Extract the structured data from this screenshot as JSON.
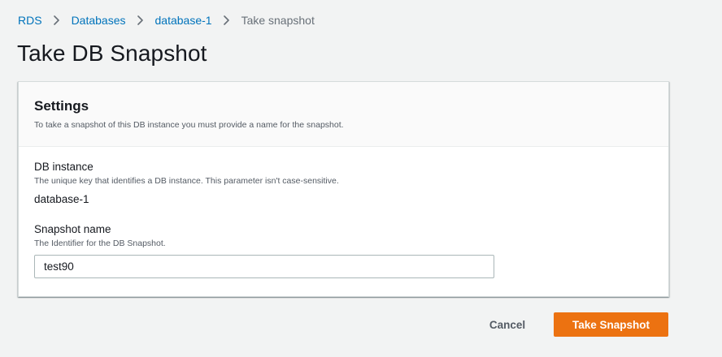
{
  "breadcrumb": {
    "items": [
      {
        "label": "RDS",
        "link": true
      },
      {
        "label": "Databases",
        "link": true
      },
      {
        "label": "database-1",
        "link": true
      },
      {
        "label": "Take snapshot",
        "link": false
      }
    ],
    "separator_icon": "chevron-right-icon"
  },
  "page": {
    "title": "Take DB Snapshot"
  },
  "settings": {
    "title": "Settings",
    "description": "To take a snapshot of this DB instance you must provide a name for the snapshot.",
    "db_instance": {
      "label": "DB instance",
      "description": "The unique key that identifies a DB instance. This parameter isn't case-sensitive.",
      "value": "database-1"
    },
    "snapshot_name": {
      "label": "Snapshot name",
      "description": "The Identifier for the DB Snapshot.",
      "value": "test90"
    }
  },
  "actions": {
    "cancel_label": "Cancel",
    "submit_label": "Take Snapshot"
  },
  "colors": {
    "link": "#0073bb",
    "primary_button": "#ec7211",
    "page_background": "#f2f3f3",
    "muted_text": "#687078"
  }
}
